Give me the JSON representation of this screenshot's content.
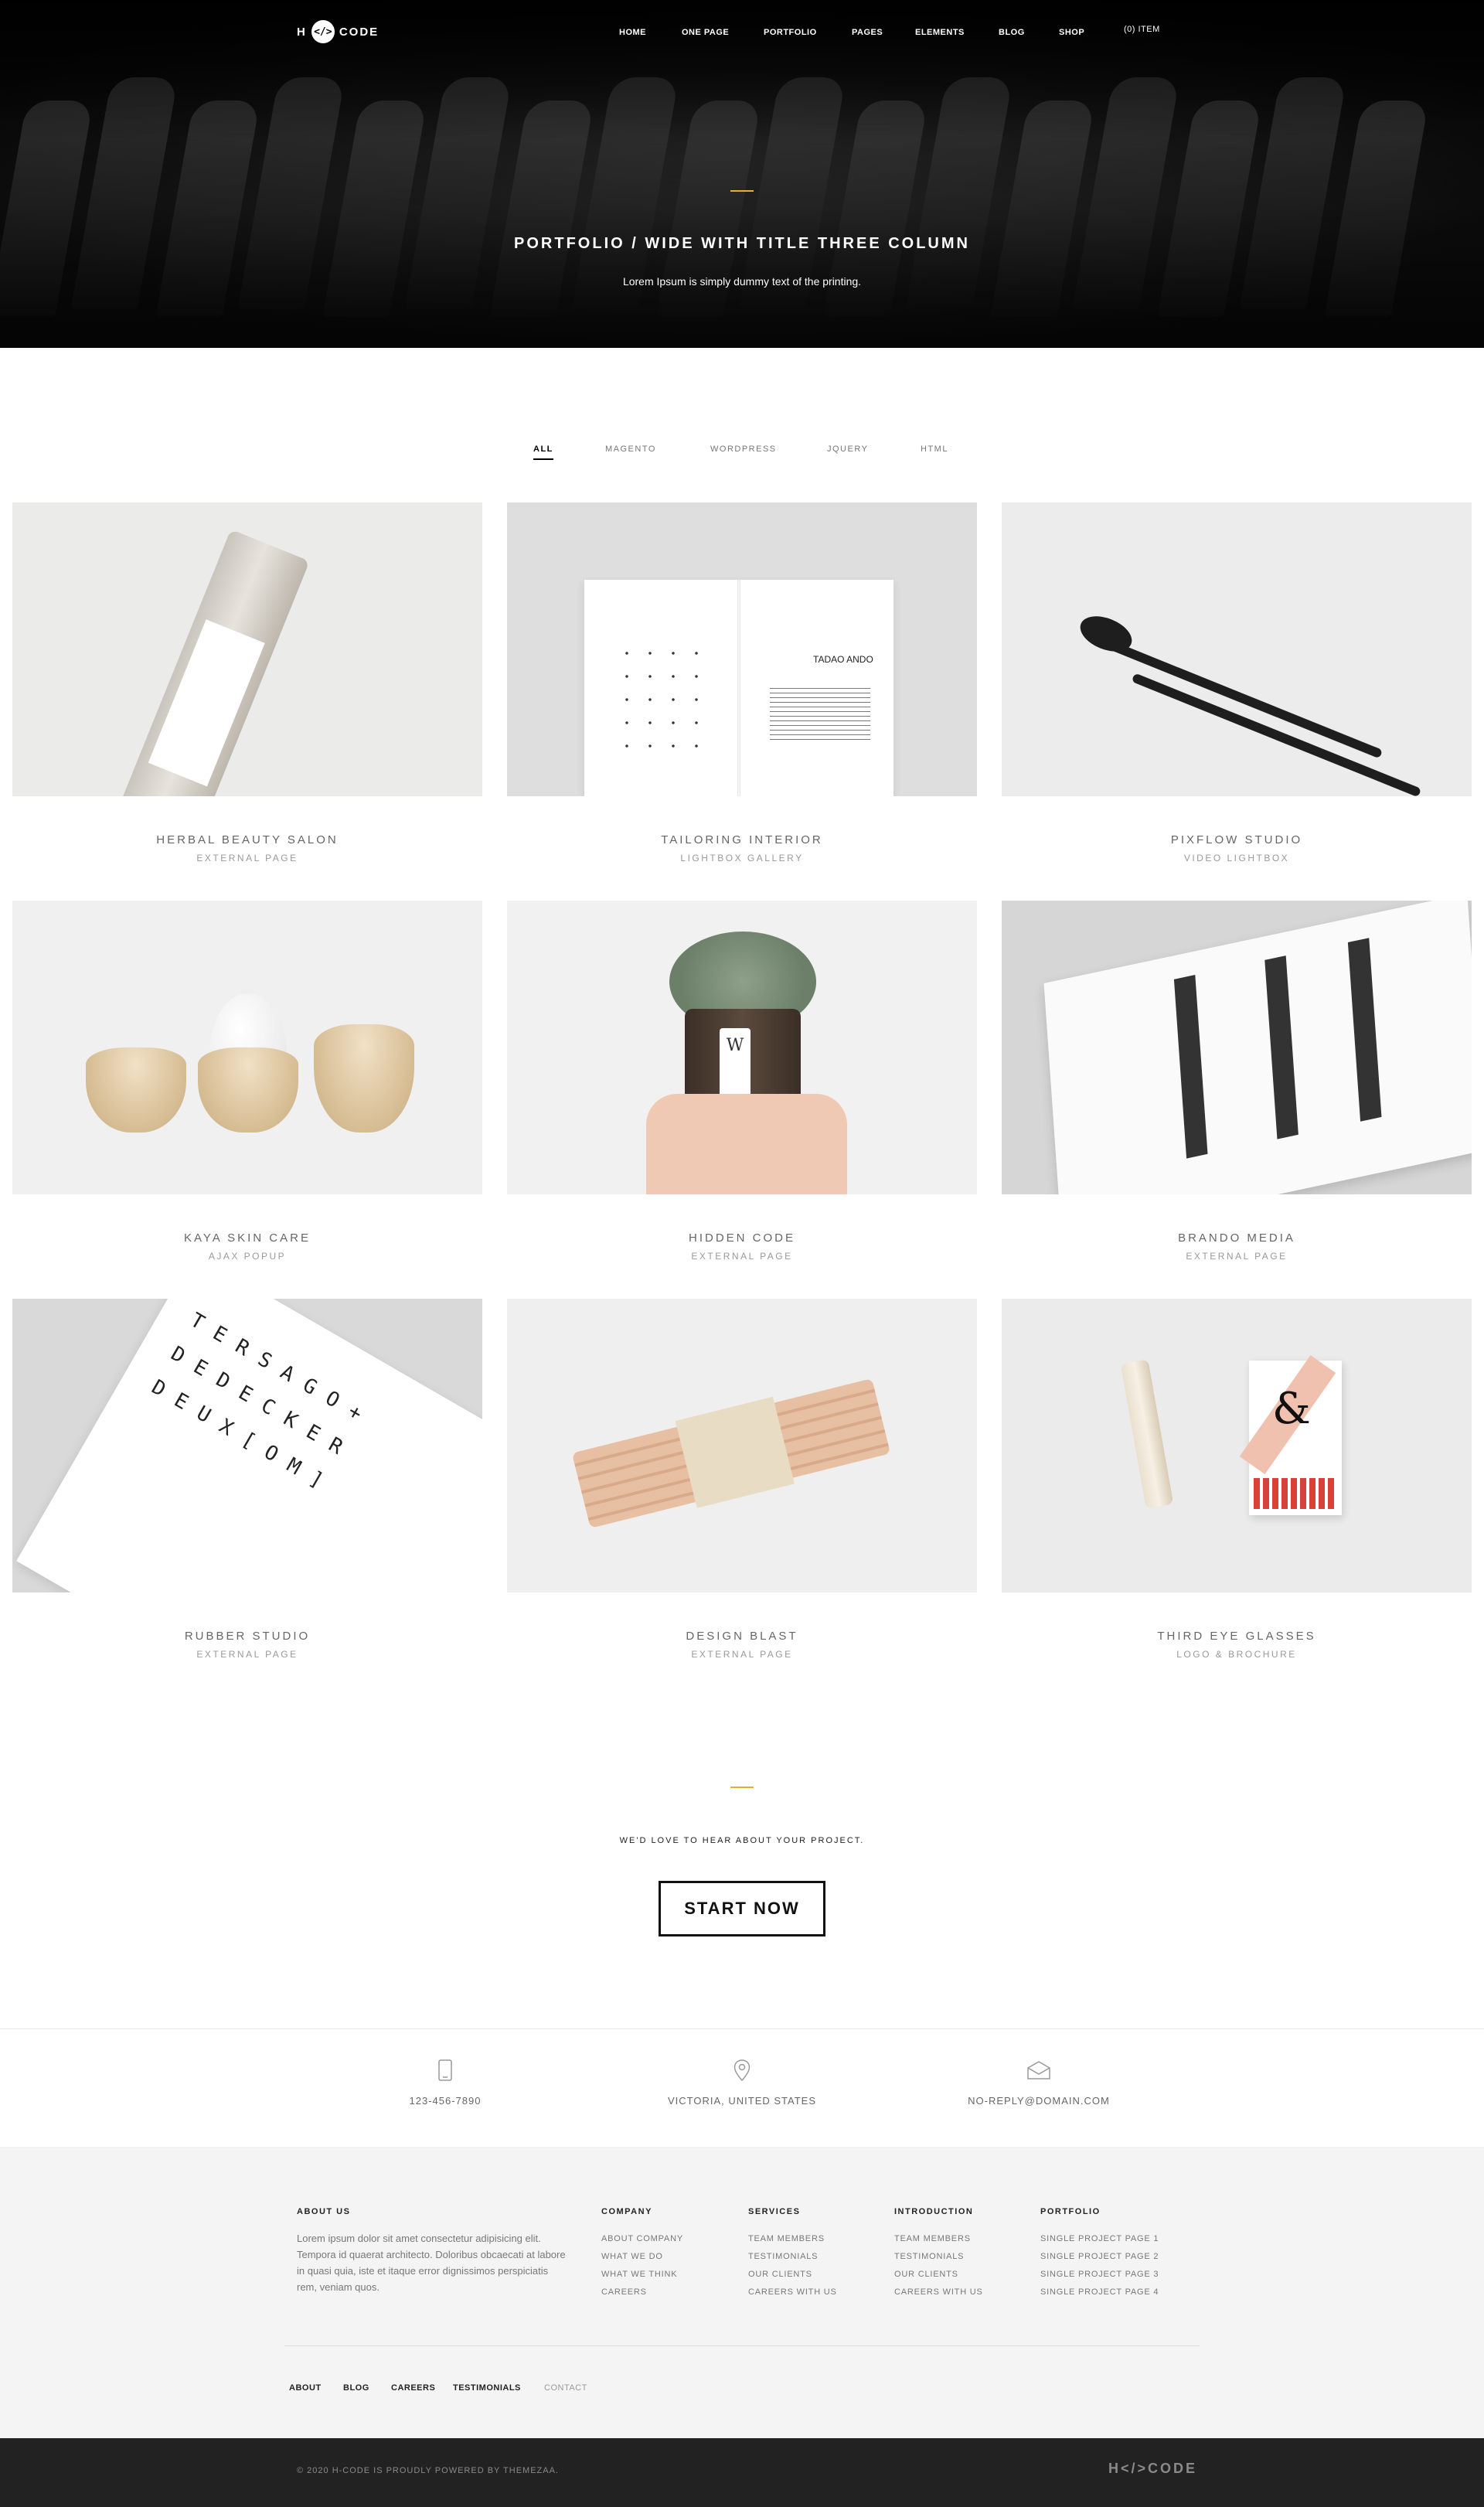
{
  "header": {
    "logo": {
      "left": "H",
      "mark": "</>",
      "right": "CODE"
    },
    "menu": [
      "HOME",
      "ONE PAGE",
      "PORTFOLIO",
      "PAGES",
      "ELEMENTS",
      "BLOG",
      "SHOP",
      "(0) ITEM"
    ]
  },
  "hero": {
    "title": "PORTFOLIO / WIDE WITH TITLE THREE COLUMN",
    "subtitle": "Lorem Ipsum is simply dummy text of the printing."
  },
  "filters": [
    "ALL",
    "MAGENTO",
    "WORDPRESS",
    "JQUERY",
    "HTML"
  ],
  "portfolio": [
    {
      "title": "HERBAL BEAUTY SALON",
      "category": "EXTERNAL PAGE"
    },
    {
      "title": "TAILORING INTERIOR",
      "category": "LIGHTBOX GALLERY"
    },
    {
      "title": "PIXFLOW STUDIO",
      "category": "VIDEO LIGHTBOX"
    },
    {
      "title": "KAYA SKIN CARE",
      "category": "AJAX POPUP"
    },
    {
      "title": "HIDDEN CODE",
      "category": "EXTERNAL PAGE"
    },
    {
      "title": "BRANDO MEDIA",
      "category": "EXTERNAL PAGE"
    },
    {
      "title": "RUBBER STUDIO",
      "category": "EXTERNAL PAGE"
    },
    {
      "title": "DESIGN BLAST",
      "category": "EXTERNAL PAGE"
    },
    {
      "title": "THIRD EYE GLASSES",
      "category": "LOGO & BROCHURE"
    }
  ],
  "image_text": {
    "book": "TADAO ANDO",
    "paper": [
      "TERSAGO+",
      "DEDECKER",
      "DEUX[OM]"
    ],
    "jar": "W",
    "matchbox": "&"
  },
  "cta": {
    "text": "WE'D LOVE TO HEAR ABOUT YOUR PROJECT.",
    "button": "START NOW"
  },
  "contact": {
    "phone": "123-456-7890",
    "location": "VICTORIA, UNITED STATES",
    "email": "NO-REPLY@DOMAIN.COM"
  },
  "footer": {
    "about": {
      "heading": "ABOUT US",
      "text": "Lorem ipsum dolor sit amet consectetur adipisicing elit. Tempora id quaerat architecto. Doloribus obcaecati at labore in quasi quia, iste et itaque error dignissimos perspiciatis rem, veniam quos."
    },
    "columns": [
      {
        "heading": "COMPANY",
        "links": [
          "ABOUT COMPANY",
          "WHAT WE DO",
          "WHAT WE THINK",
          "CAREERS"
        ]
      },
      {
        "heading": "SERVICES",
        "links": [
          "TEAM MEMBERS",
          "TESTIMONIALS",
          "OUR CLIENTS",
          "CAREERS WITH US"
        ]
      },
      {
        "heading": "INTRODUCTION",
        "links": [
          "TEAM MEMBERS",
          "TESTIMONIALS",
          "OUR CLIENTS",
          "CAREERS WITH US"
        ]
      },
      {
        "heading": "PORTFOLIO",
        "links": [
          "SINGLE PROJECT PAGE 1",
          "SINGLE PROJECT PAGE 2",
          "SINGLE PROJECT PAGE 3",
          "SINGLE PROJECT PAGE 4"
        ]
      }
    ],
    "bottom_links": [
      "ABOUT",
      "BLOG",
      "CAREERS",
      "TESTIMONIALS",
      "CONTACT"
    ],
    "copyright": "© 2020 H-CODE IS PROUDLY POWERED BY THEMEZAA.",
    "logo": "H</>CODE"
  },
  "colors": {
    "accent": "#e6af2a",
    "footer_bg": "#f4f4f4",
    "bottom_bar": "#222222"
  }
}
